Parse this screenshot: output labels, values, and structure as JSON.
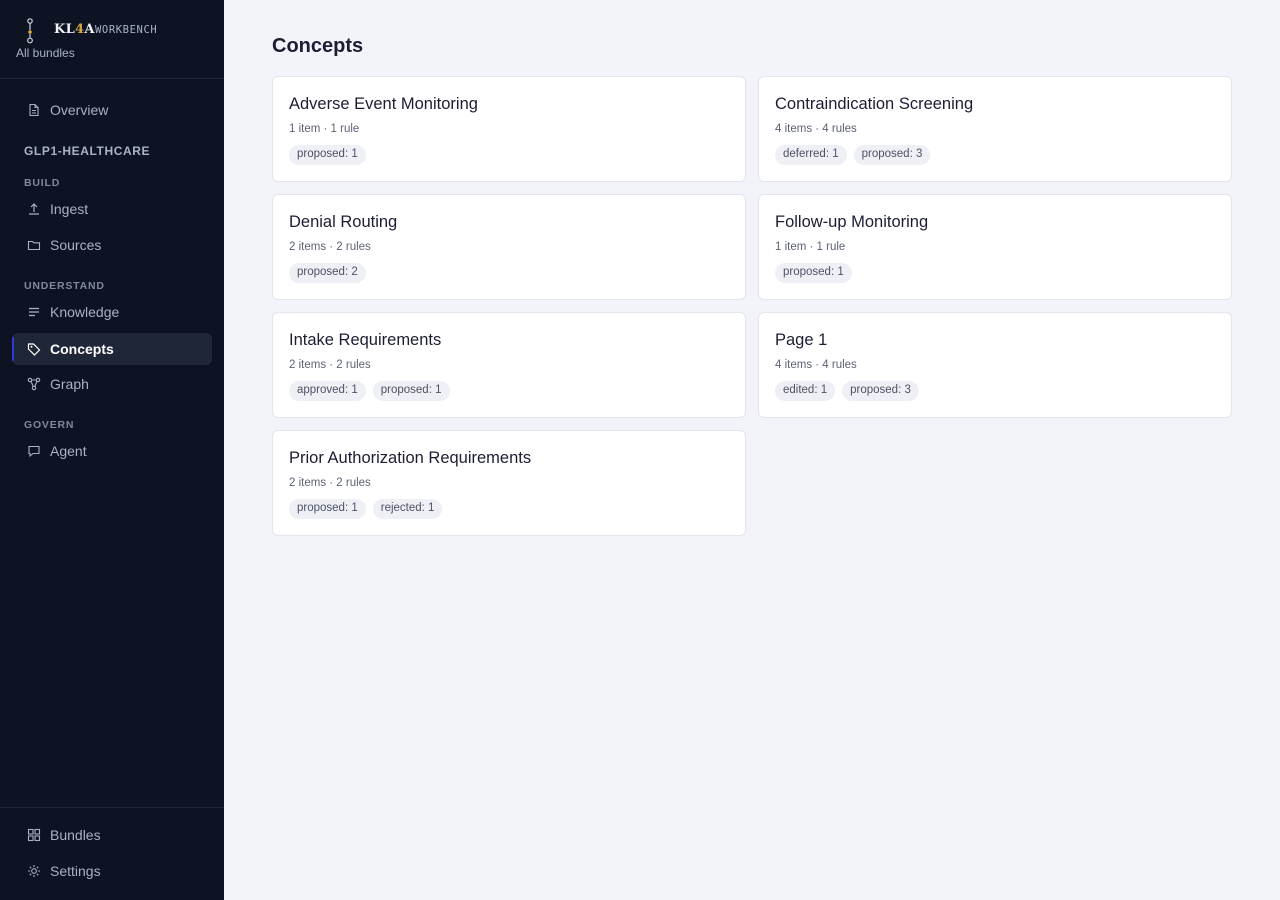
{
  "brand": {
    "name_prefix": "KL",
    "name_accent": "4",
    "name_suffix": "A",
    "suffix_label": "WORKBENCH",
    "all_bundles_link": "All bundles",
    "accent_color": "#d9a842"
  },
  "sidebar": {
    "overview": {
      "label": "Overview",
      "icon": "document-icon"
    },
    "project_name": "GLP1-HEALTHCARE",
    "sections": [
      {
        "label": "BUILD",
        "items": [
          {
            "label": "Ingest",
            "icon": "upload-icon"
          },
          {
            "label": "Sources",
            "icon": "folder-icon"
          }
        ]
      },
      {
        "label": "UNDERSTAND",
        "items": [
          {
            "label": "Knowledge",
            "icon": "list-icon"
          },
          {
            "label": "Concepts",
            "icon": "tag-icon",
            "active": true
          },
          {
            "label": "Graph",
            "icon": "graph-icon"
          }
        ]
      },
      {
        "label": "GOVERN",
        "items": [
          {
            "label": "Agent",
            "icon": "chat-icon"
          }
        ]
      }
    ],
    "footer": [
      {
        "label": "Bundles",
        "icon": "grid-icon"
      },
      {
        "label": "Settings",
        "icon": "gear-icon"
      }
    ],
    "background": "#0d1322",
    "active_accent": "#2e3bd6"
  },
  "main": {
    "title": "Concepts",
    "cards": [
      {
        "title": "Adverse Event Monitoring",
        "meta": "1 item · 1 rule",
        "badges": [
          "proposed: 1"
        ]
      },
      {
        "title": "Contraindication Screening",
        "meta": "4 items · 4 rules",
        "badges": [
          "deferred: 1",
          "proposed: 3"
        ]
      },
      {
        "title": "Denial Routing",
        "meta": "2 items · 2 rules",
        "badges": [
          "proposed: 2"
        ]
      },
      {
        "title": "Follow-up Monitoring",
        "meta": "1 item · 1 rule",
        "badges": [
          "proposed: 1"
        ]
      },
      {
        "title": "Intake Requirements",
        "meta": "2 items · 2 rules",
        "badges": [
          "approved: 1",
          "proposed: 1"
        ]
      },
      {
        "title": "Page 1",
        "meta": "4 items · 4 rules",
        "badges": [
          "edited: 1",
          "proposed: 3"
        ]
      },
      {
        "title": "Prior Authorization Requirements",
        "meta": "2 items · 2 rules",
        "badges": [
          "proposed: 1",
          "rejected: 1"
        ]
      }
    ]
  }
}
